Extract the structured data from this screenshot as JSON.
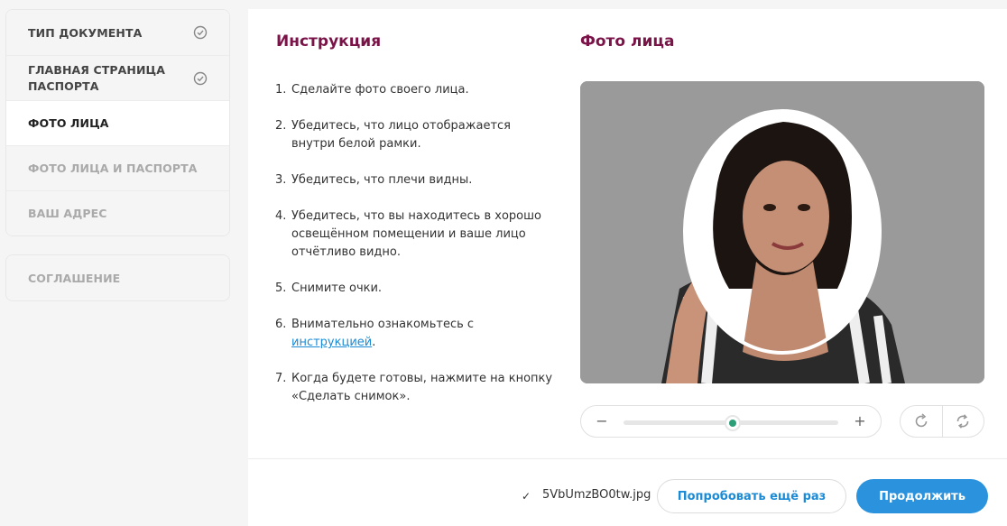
{
  "sidebar": {
    "group1": [
      {
        "label": "ТИП ДОКУМЕНТА",
        "state": "done"
      },
      {
        "label": "ГЛАВНАЯ СТРАНИЦА\nПАСПОРТА",
        "state": "done"
      },
      {
        "label": "ФОТО ЛИЦА",
        "state": "active"
      },
      {
        "label": "ФОТО ЛИЦА И ПАСПОРТА",
        "state": "pending"
      },
      {
        "label": "ВАШ АДРЕС",
        "state": "pending"
      }
    ],
    "group2": [
      {
        "label": "СОГЛАШЕНИЕ",
        "state": "pending"
      }
    ]
  },
  "instructions": {
    "title": "Инструкция",
    "steps": [
      {
        "num": "1.",
        "text": "Сделайте фото своего лица."
      },
      {
        "num": "2.",
        "text": "Убедитесь, что лицо отображается внутри белой рамки."
      },
      {
        "num": "3.",
        "text": "Убедитесь, что плечи видны."
      },
      {
        "num": "4.",
        "text": "Убедитесь, что вы находитесь в хорошо освещённом помещении и ваше лицо отчётливо видно."
      },
      {
        "num": "5.",
        "text": "Снимите очки."
      },
      {
        "num": "6.",
        "text_before": "Внимательно ознакомьтесь с ",
        "link": "инструкцией",
        "text_after": "."
      },
      {
        "num": "7.",
        "text": "Когда будете готовы, нажмите на кнопку «Сделать снимок»."
      }
    ]
  },
  "photo": {
    "title": "Фото лица",
    "zoom": {
      "minus": "−",
      "plus": "+",
      "level": 0.51
    },
    "rotate_icon": "rotate-clockwise-icon",
    "flip_icon": "flip-rotate-icon"
  },
  "footer": {
    "check": "✓",
    "file_name": "5VbUmzBO0tw.jpg",
    "retry_label": "Попробовать ещё раз",
    "continue_label": "Продолжить"
  },
  "colors": {
    "accent_title": "#7a1347",
    "link": "#1b8bd6",
    "primary_button": "#2b93dd",
    "slider_thumb": "#2c9e78"
  }
}
